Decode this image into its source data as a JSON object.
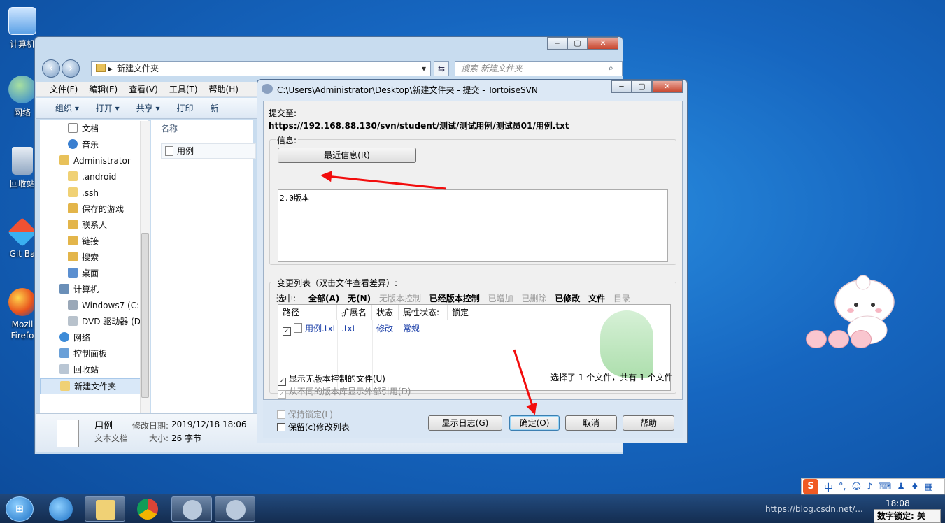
{
  "desktop": {
    "icons": [
      "计算机",
      "网络",
      "回收站",
      "Git Ba",
      "Mozil\nFirefo"
    ]
  },
  "explorer": {
    "breadcrumb": "新建文件夹",
    "search_placeholder": "搜索 新建文件夹",
    "menu": [
      "文件(F)",
      "编辑(E)",
      "查看(V)",
      "工具(T)",
      "帮助(H)"
    ],
    "toolbar": [
      "组织 ▾",
      "打开 ▾",
      "共享 ▾",
      "打印",
      "新"
    ],
    "nav_items": [
      "文档",
      "音乐",
      "Administrator",
      ".android",
      ".ssh",
      "保存的游戏",
      "联系人",
      "链接",
      "搜索",
      "桌面",
      "计算机",
      "Windows7 (C:",
      "DVD 驱动器 (D",
      "网络",
      "控制面板",
      "回收站",
      "新建文件夹"
    ],
    "column_header": "名称",
    "file": "用例",
    "details": {
      "name": "用例",
      "type": "文本文档",
      "modified_label": "修改日期:",
      "modified_value": "2019/12/18 18:06",
      "size_label": "大小:",
      "size_value": "26 字节"
    }
  },
  "svn": {
    "title": "C:\\Users\\Administrator\\Desktop\\新建文件夹 - 提交 - TortoiseSVN",
    "commit_to_label": "提交至:",
    "commit_url": "https://192.168.88.130/svn/student/测试/测试用例/测试员01/用例.txt",
    "message_label": "信息:",
    "recent_button": "最近信息(R)",
    "message_text": "2.0版本",
    "changes_label": "变更列表（双击文件查看差异）:",
    "select_label": "选中:",
    "filters": [
      {
        "label": "全部(A)",
        "enabled": true
      },
      {
        "label": "无(N)",
        "enabled": true
      },
      {
        "label": "无版本控制",
        "enabled": false
      },
      {
        "label": "已经版本控制",
        "enabled": true
      },
      {
        "label": "已增加",
        "enabled": false
      },
      {
        "label": "已删除",
        "enabled": false
      },
      {
        "label": "已修改",
        "enabled": true
      },
      {
        "label": "文件",
        "enabled": true
      },
      {
        "label": "目录",
        "enabled": false
      }
    ],
    "columns": [
      "路径",
      "扩展名",
      "状态",
      "属性状态:",
      "锁定"
    ],
    "rows": [
      {
        "path": "用例.txt",
        "ext": ".txt",
        "status": "修改",
        "prop": "常规",
        "lock": ""
      }
    ],
    "show_unversioned": "显示无版本控制的文件(U)",
    "show_externals": "从不同的版本库显示外部引用(D)",
    "selection_summary": "选择了 1 个文件，共有 1 个文件",
    "keep_locks": "保持锁定(L)",
    "keep_changelist": "保留(c)修改列表",
    "buttons": {
      "log": "显示日志(G)",
      "ok": "确定(O)",
      "cancel": "取消",
      "help": "帮助"
    }
  },
  "taskbar": {
    "clock": "18:08",
    "watermark": "https://blog.csdn.net/...",
    "numlock": "数字锁定: 关",
    "ime": "中"
  },
  "colors": {
    "accent_arrow": "#f20d0d",
    "svn_text_blue": "#1a3ea8"
  }
}
